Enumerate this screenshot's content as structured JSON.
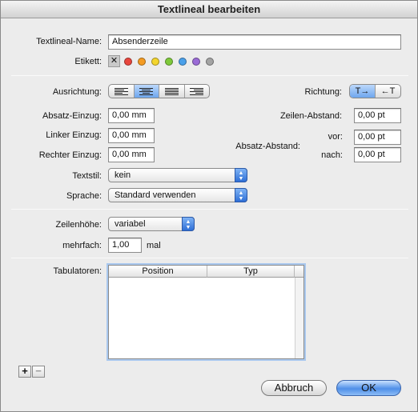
{
  "window": {
    "title": "Textlineal bearbeiten"
  },
  "name": {
    "label": "Textlineal-Name:",
    "value": "Absenderzeile"
  },
  "tag": {
    "label": "Etikett:",
    "none_symbol": "✕",
    "colors": [
      "#e8463d",
      "#f49b22",
      "#f3d52d",
      "#7ec93a",
      "#4aa0ea",
      "#9a6bd6",
      "#a4a4a4"
    ]
  },
  "alignment": {
    "label": "Ausrichtung:",
    "options": [
      "left",
      "center",
      "justify",
      "right"
    ],
    "selected": "center"
  },
  "direction": {
    "label": "Richtung:",
    "options": [
      "T→",
      "←T"
    ],
    "selected": "T→"
  },
  "indents": {
    "paragraph": {
      "label": "Absatz-Einzug:",
      "value": "0,00 mm"
    },
    "left": {
      "label": "Linker Einzug:",
      "value": "0,00 mm"
    },
    "right": {
      "label": "Rechter Einzug:",
      "value": "0,00 mm"
    }
  },
  "spacing": {
    "line": {
      "label": "Zeilen-Abstand:",
      "value": "0,00 pt"
    },
    "paragraph_label": "Absatz-Abstand:",
    "before": {
      "label": "vor:",
      "value": "0,00 pt"
    },
    "after": {
      "label": "nach:",
      "value": "0,00 pt"
    }
  },
  "textstyle": {
    "label": "Textstil:",
    "value": "kein"
  },
  "language": {
    "label": "Sprache:",
    "value": "Standard verwenden"
  },
  "line_height": {
    "label": "Zeilenhöhe:",
    "value": "variabel"
  },
  "multiple": {
    "label": "mehrfach:",
    "value": "1,00",
    "unit": "mal"
  },
  "tabs": {
    "label": "Tabulatoren:",
    "columns": [
      "Position",
      "Typ"
    ],
    "rows": [],
    "add_label": "+",
    "remove_label": "−"
  },
  "buttons": {
    "cancel": "Abbruch",
    "ok": "OK"
  }
}
